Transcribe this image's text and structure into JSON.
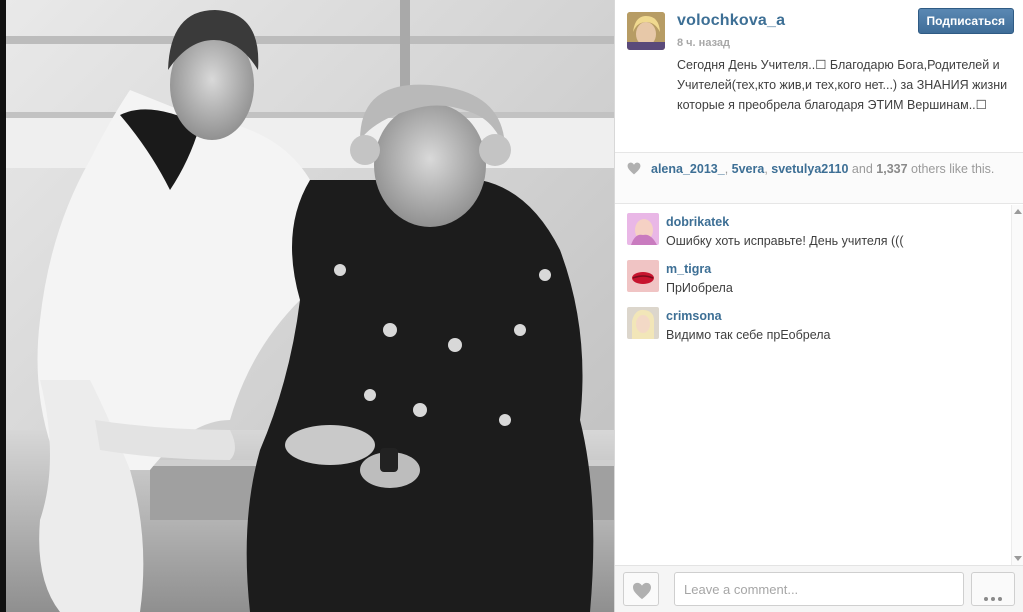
{
  "post": {
    "owner": "volochkova_a",
    "timestamp": "8 ч. назад",
    "follow_label": "Подписаться",
    "caption": "Сегодня День Учителя..☐ Благодарю Бога,Родителей и Учителей(тех,кто жив,и тех,кого нет...) за ЗНАНИЯ жизни которые я преобрела благодаря ЭТИМ Вершинам..☐"
  },
  "likes": {
    "user1": "alena_2013_",
    "user2": "5vera",
    "user3": "svetulya2110",
    "and_text": "and",
    "count": "1,337",
    "suffix": "others like this."
  },
  "comments": [
    {
      "user": "dobrikatek",
      "text": "Ошибку хоть исправьте! День учителя ((("
    },
    {
      "user": "m_tigra",
      "text": "ПрИобрела"
    },
    {
      "user": "crimsona",
      "text": "Видимо так себе прЕобрела"
    }
  ],
  "footer": {
    "comment_placeholder": "Leave a comment..."
  },
  "colors": {
    "link": "#3d6f95",
    "follow_button": "#4a78a4",
    "muted": "#a8a8a8"
  },
  "icons": {
    "like": "heart-icon",
    "more": "more-dots-icon"
  }
}
